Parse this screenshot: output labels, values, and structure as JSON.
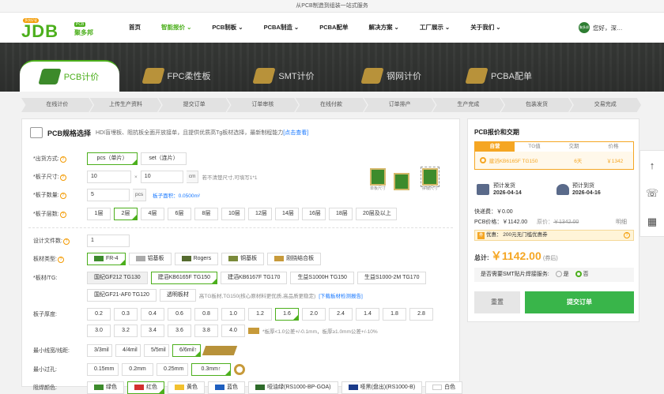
{
  "topstrip": "从PCB制造到组装一站式服务",
  "logo": {
    "brand": "JDB",
    "pcb_tag": "PCB",
    "cn": "聚多邦",
    "badge": "多快好省"
  },
  "nav": {
    "items": [
      "首页",
      "智能报价 ⌄",
      "PCB制板 ⌄",
      "PCBA制造 ⌄",
      "PCBA配单",
      "解决方案 ⌄",
      "工厂展示 ⌄",
      "关于我们 ⌄"
    ],
    "active_index": 1,
    "user_badge": "聚多邦",
    "user": "您好，深…"
  },
  "tabs": [
    "PCB计价",
    "FPC柔性板",
    "SMT计价",
    "钢网计价",
    "PCBA配单"
  ],
  "steps": [
    "在线计价",
    "上传生产资料",
    "提交订单",
    "订单审核",
    "在线付款",
    "订单排产",
    "生产完成",
    "包装发货",
    "交易完成"
  ],
  "spec": {
    "title": "PCB规格选择",
    "desc": "HDI盲埋板、阻抗板全面开放接单，且提供优质高Tg板材选择，最新制程能力",
    "desc_link": "[点击查看]",
    "ship_label": "*出货方式:",
    "ship_opts": [
      "pcs（单片）",
      "set（连片）"
    ],
    "size_label": "*板子尺寸:",
    "size_w": "10",
    "size_x": "×",
    "size_h": "10",
    "size_unit": "cm",
    "size_note": "若不清楚尺寸,可填写1*1",
    "qty_label": "*板子数量:",
    "qty": "5",
    "qty_unit": "pcs",
    "area": "板子面积：0.0500m²",
    "thumb_single": "单板尺寸",
    "thumb_panel": "拼版尺寸",
    "layer_label": "*板子层数:",
    "layers": [
      "1层",
      "2层",
      "4层",
      "6层",
      "8层",
      "10层",
      "12层",
      "14层",
      "16层",
      "18层",
      "20层及以上"
    ],
    "files_label": "设计文件数:",
    "files": "1",
    "material_label": "板材类型:",
    "materials": [
      "FR-4",
      "铝基板",
      "Rogers",
      "铜基板",
      "刚挠结合板"
    ],
    "tg_label": "*板材/TG:",
    "tg_opts": [
      "国纪GF212 TG130",
      "建滔KB6165F TG150",
      "建滔KB6167F TG170",
      "生益S1000H TG150",
      "生益S1000-2M TG170",
      "国纪GF21-AF0 TG120",
      "透明板材"
    ],
    "tg_note": "高TG板材,TG150(核心原材料更优质,高品质更稳定)",
    "tg_link": "[下载板材检测报告]",
    "thick_label": "板子厚度:",
    "thick": [
      "0.2",
      "0.3",
      "0.4",
      "0.6",
      "0.8",
      "1.0",
      "1.2",
      "1.6",
      "2.0",
      "2.4",
      "1.4",
      "1.8",
      "2.8",
      "3.0",
      "3.2",
      "3.4",
      "3.6",
      "3.8",
      "4.0"
    ],
    "thick_note": "*板厚<1.0公差+/-0.1mm，板厚≥1.0mm公差+/-10%",
    "trace_label": "最小线宽/线距:",
    "trace": [
      "3/3mil",
      "4/4mil",
      "5/5mil",
      "6/6mil↑"
    ],
    "hole_label": "最小过孔:",
    "holes": [
      "0.15mm",
      "0.2mm",
      "0.25mm",
      "0.3mm↑"
    ],
    "color_label": "阻焊颜色:",
    "colors": [
      "绿色",
      "红色",
      "黄色",
      "蓝色",
      "哑油绿(RS1000-BP-GOA)",
      "哑黑(盘出)(RS1000-B)",
      "白色"
    ]
  },
  "quote": {
    "title": "PCB报价和交期",
    "cols": [
      "自营",
      "TG值",
      "交期",
      "价格"
    ],
    "row_name": "建滔KB6165F TG150",
    "row_days": "6天",
    "row_price": "￥1342",
    "ship_label": "预计发货",
    "ship_date": "2026-04-14",
    "arrive_label": "预计到货",
    "arrive_date": "2026-04-16",
    "express": "快递费：￥0.00",
    "pcb_price_label": "PCB价格：",
    "pcb_price": "￥1142.00",
    "orig_label": "原价：",
    "orig_price": "￥1342.00",
    "detail": "明细",
    "coupon_tag": "券",
    "coupon": "优惠： 200元无门槛优惠券",
    "total_label": "总计:",
    "total": "￥1142.00",
    "total_sub": "(券后)",
    "smt_q": "是否需要SMT贴片焊接服务:",
    "smt_yes": "是",
    "smt_no": "否",
    "reset": "重置",
    "submit": "提交订单"
  },
  "colors": {
    "brand": "#4caf1c",
    "accent": "#f5a623",
    "link": "#1677ff"
  }
}
